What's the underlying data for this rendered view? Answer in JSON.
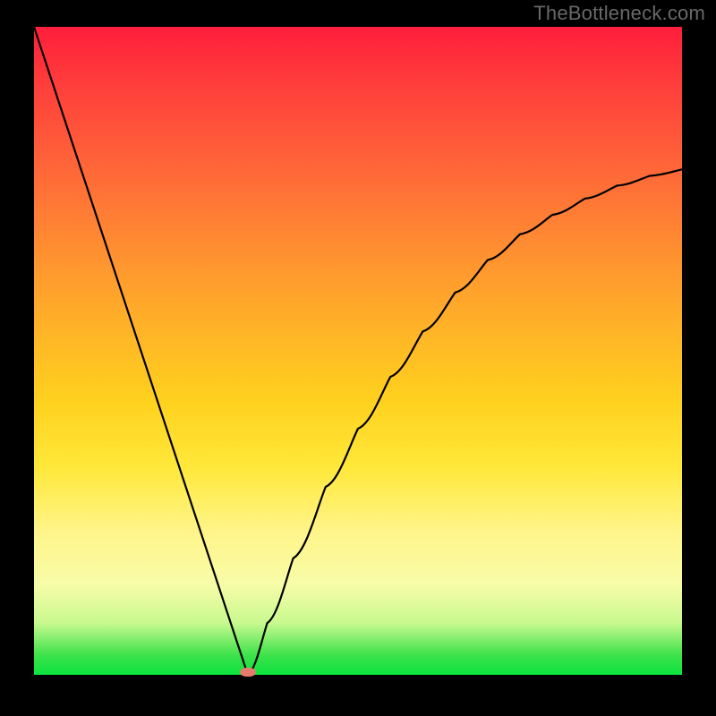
{
  "watermark": "TheBottleneck.com",
  "chart_data": {
    "type": "line",
    "title": "",
    "xlabel": "",
    "ylabel": "",
    "xlim": [
      0,
      100
    ],
    "ylim": [
      0,
      100
    ],
    "legend": false,
    "grid": false,
    "background_gradient": {
      "orientation": "vertical",
      "stops": [
        {
          "pos": 0.0,
          "color": "#ff1e3c"
        },
        {
          "pos": 0.5,
          "color": "#ffb726"
        },
        {
          "pos": 0.8,
          "color": "#fff58a"
        },
        {
          "pos": 0.97,
          "color": "#3de24a"
        },
        {
          "pos": 1.0,
          "color": "#0be33f"
        }
      ]
    },
    "curve": {
      "note": "V-shaped bottleneck curve; y is bottleneck %, minimum near x≈33",
      "x": [
        0,
        5,
        10,
        15,
        20,
        25,
        30,
        33,
        36,
        40,
        45,
        50,
        55,
        60,
        65,
        70,
        75,
        80,
        85,
        90,
        95,
        100
      ],
      "y": [
        100,
        85,
        70,
        55,
        40,
        25,
        10,
        0,
        8,
        18,
        29,
        38,
        46,
        53,
        59,
        64,
        68,
        71,
        73.5,
        75.5,
        77,
        78
      ]
    },
    "marker": {
      "x": 33,
      "y": 0,
      "color": "#e77a6f",
      "shape": "ellipse"
    }
  },
  "colors": {
    "frame": "#000000",
    "watermark": "#696969",
    "curve_stroke": "#000000",
    "marker": "#e77a6f"
  }
}
